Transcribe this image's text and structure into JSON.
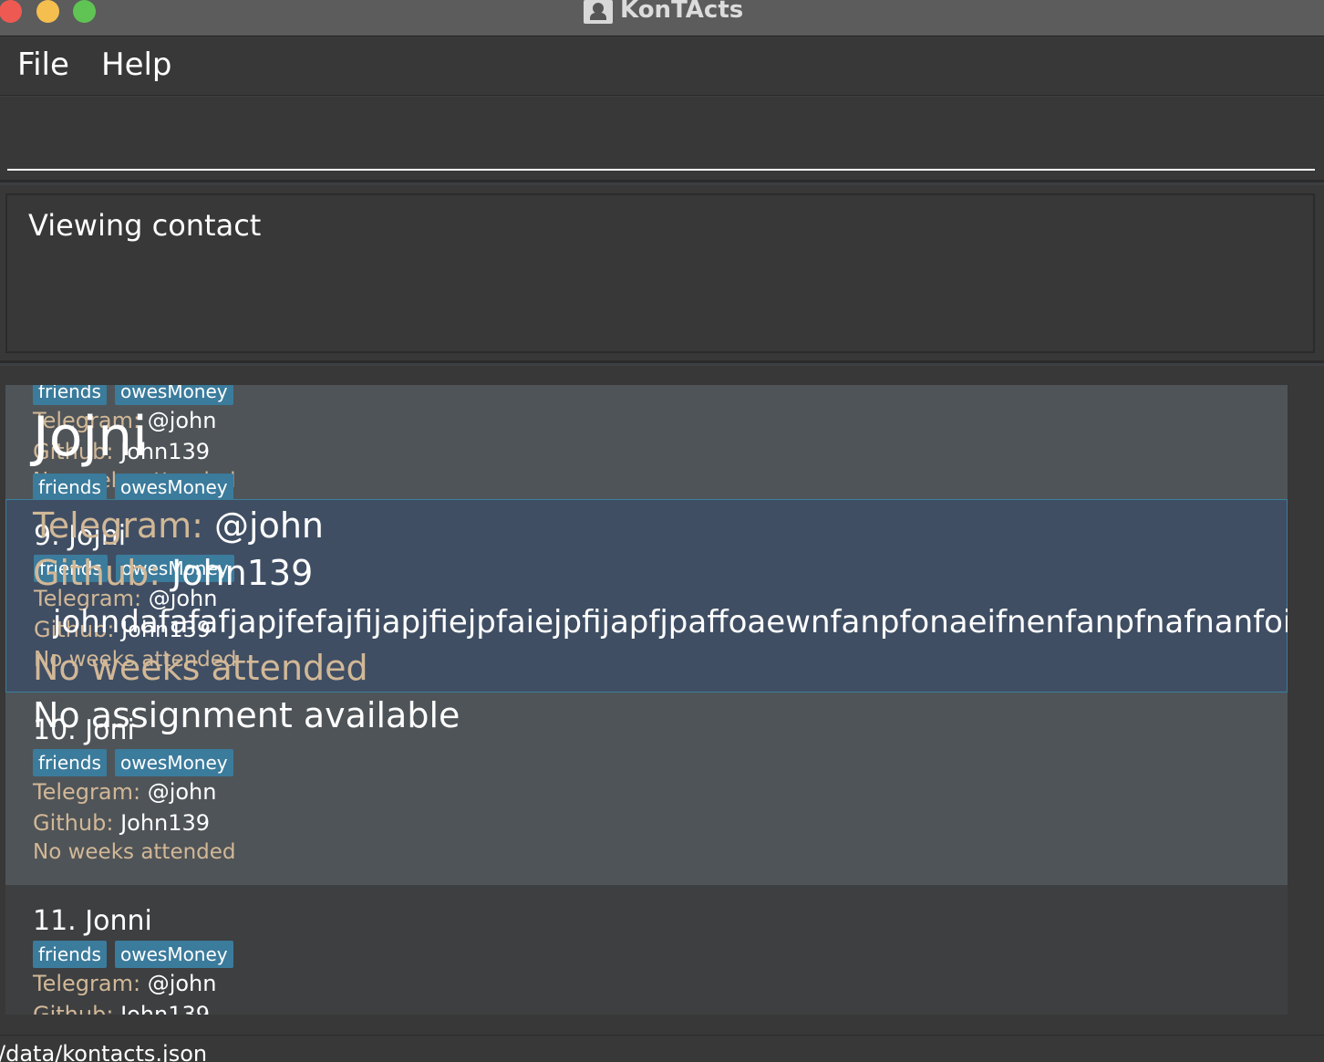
{
  "window": {
    "title": "KonTActs"
  },
  "menu": {
    "file": "File",
    "help": "Help"
  },
  "command_box": {
    "value": ""
  },
  "result_display": {
    "text": "Viewing contact"
  },
  "contacts": {
    "partial_top": {
      "telegram_label": "Telegram:",
      "telegram": "@john",
      "github_label": "Github:",
      "github": "John139",
      "weeks": "No weeks attended",
      "tags": [
        "friends",
        "owesMoney"
      ]
    },
    "selected": {
      "title": "9. Jojni",
      "tags": [
        "friends",
        "owesMoney"
      ],
      "telegram_label": "Telegram:",
      "telegram": "@john",
      "github_label": "Github:",
      "github": "John139",
      "weeks": "No weeks attended"
    },
    "card10": {
      "title": "10. Joni",
      "tags": [
        "friends",
        "owesMoney"
      ],
      "telegram_label": "Telegram:",
      "telegram": "@john",
      "github_label": "Github:",
      "github": "John139",
      "weeks": "No weeks attended"
    },
    "card11": {
      "title": "11. Jonni",
      "tags": [
        "friends",
        "owesMoney"
      ],
      "telegram_label": "Telegram:",
      "telegram": "@john",
      "github_label": "Github:",
      "github": "John139"
    }
  },
  "detail_view": {
    "name": "Jojni",
    "telegram_label": "Telegram:",
    "telegram": "@john",
    "github_label": "Github:",
    "github": "John139",
    "repo": "johndafafafjapjfefajfijapjfiejpfaiejpfijapfjpaffoaewnfanpfonaeifnenfanpfnafnanfoi...",
    "weeks": "No weeks attended",
    "assignment": "No assignment available"
  },
  "status_bar": {
    "path": "/data/kontacts.json"
  },
  "colors": {
    "background": "#3c3f41",
    "card_alt": "#4f5458",
    "card_selected": "#3f4e63",
    "tag": "#3b7b9c",
    "label": "#d2b897"
  }
}
